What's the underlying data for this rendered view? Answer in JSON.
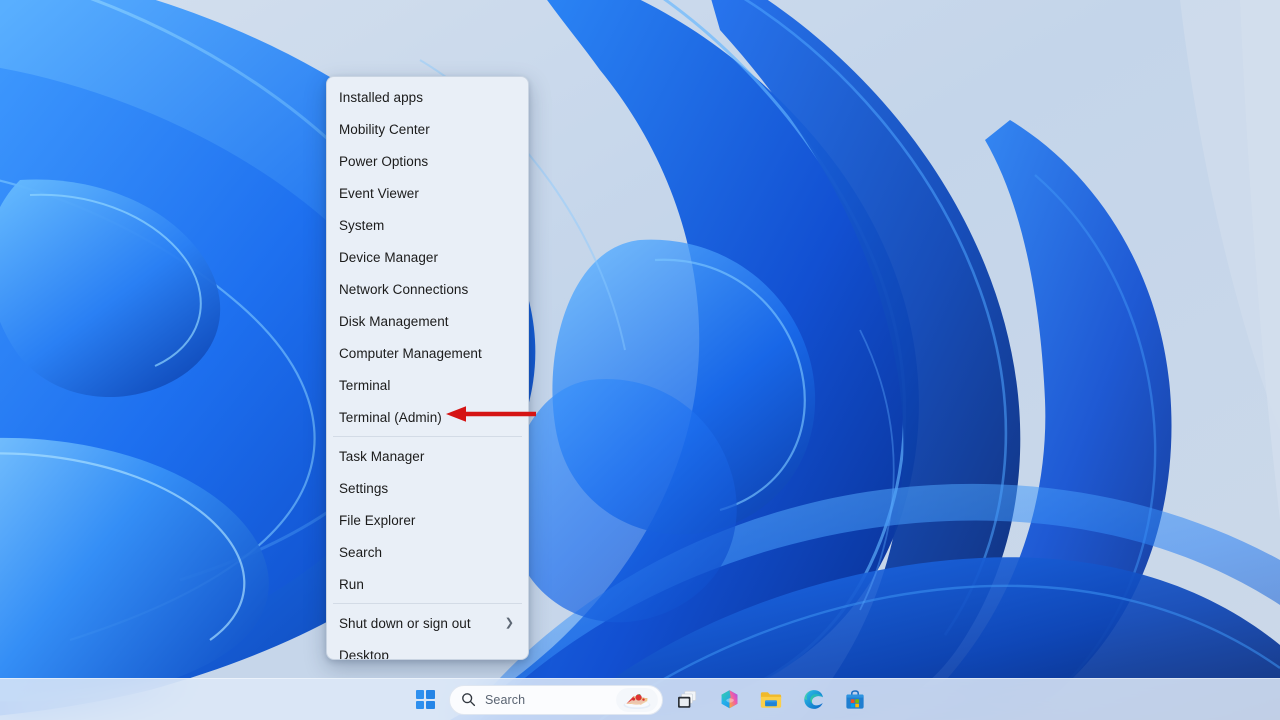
{
  "desktop": {
    "wallpaper_name": "windows-11-bloom-wallpaper",
    "bg_color": "#c6d6ea",
    "ribbon_color": "#1560e8"
  },
  "context_menu": {
    "name": "win-x-power-user-menu",
    "bg_color": "#e9eff7",
    "items": [
      {
        "label": "Installed apps",
        "type": "item",
        "icon": ""
      },
      {
        "label": "Mobility Center",
        "type": "item",
        "icon": ""
      },
      {
        "label": "Power Options",
        "type": "item",
        "icon": ""
      },
      {
        "label": "Event Viewer",
        "type": "item",
        "icon": ""
      },
      {
        "label": "System",
        "type": "item",
        "icon": ""
      },
      {
        "label": "Device Manager",
        "type": "item",
        "icon": ""
      },
      {
        "label": "Network Connections",
        "type": "item",
        "icon": ""
      },
      {
        "label": "Disk Management",
        "type": "item",
        "icon": ""
      },
      {
        "label": "Computer Management",
        "type": "item",
        "icon": ""
      },
      {
        "label": "Terminal",
        "type": "item",
        "icon": ""
      },
      {
        "label": "Terminal (Admin)",
        "type": "item",
        "icon": ""
      },
      {
        "label": "",
        "type": "separator",
        "icon": ""
      },
      {
        "label": "Task Manager",
        "type": "item",
        "icon": ""
      },
      {
        "label": "Settings",
        "type": "item",
        "icon": ""
      },
      {
        "label": "File Explorer",
        "type": "item",
        "icon": ""
      },
      {
        "label": "Search",
        "type": "item",
        "icon": ""
      },
      {
        "label": "Run",
        "type": "item",
        "icon": ""
      },
      {
        "label": "",
        "type": "separator",
        "icon": ""
      },
      {
        "label": "Shut down or sign out",
        "type": "submenu",
        "icon": "chevron-right-icon"
      },
      {
        "label": "Desktop",
        "type": "item",
        "icon": ""
      }
    ]
  },
  "annotation": {
    "name": "red-arrow-annotation",
    "color": "#d51414",
    "points_to": "Terminal (Admin)",
    "direction": "left"
  },
  "taskbar": {
    "bg_color": "#dde9f8",
    "start_button": {
      "label": "Start",
      "icon": "windows-logo-icon"
    },
    "search": {
      "placeholder": "Search",
      "icon": "search-icon",
      "badge_icon": "bing-daily-image-strawberry-cake-icon"
    },
    "buttons": [
      {
        "name": "task-view",
        "label": "Task View",
        "icon": "task-view-icon"
      },
      {
        "name": "copilot",
        "label": "Copilot",
        "icon": "copilot-icon"
      },
      {
        "name": "file-explorer",
        "label": "File Explorer",
        "icon": "folder-icon"
      },
      {
        "name": "microsoft-edge",
        "label": "Microsoft Edge",
        "icon": "edge-icon"
      },
      {
        "name": "microsoft-store",
        "label": "Microsoft Store",
        "icon": "store-bag-icon"
      }
    ]
  }
}
